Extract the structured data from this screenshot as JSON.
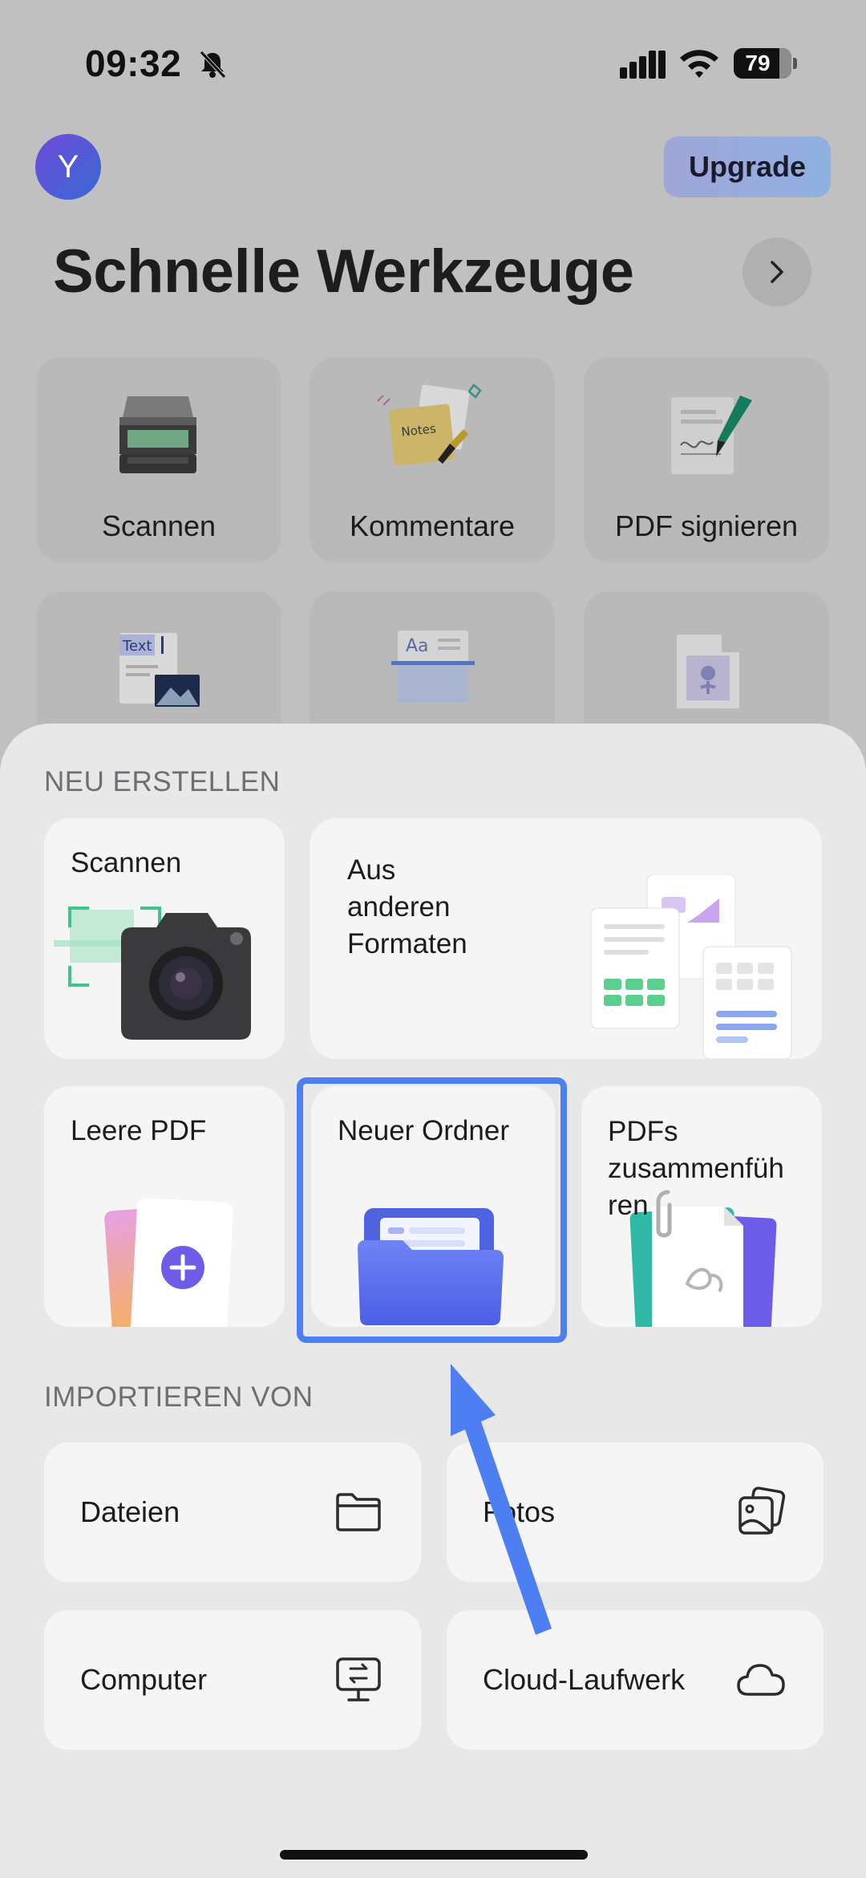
{
  "status_bar": {
    "time": "09:32",
    "battery": "79",
    "battery_level_percent": 79,
    "icons": [
      "bell-slash-icon",
      "cellular-signal-icon",
      "wifi-icon",
      "battery-icon"
    ]
  },
  "header": {
    "avatar_initial": "Y",
    "upgrade_label": "Upgrade",
    "title": "Schnelle Werkzeuge",
    "chevron_icon": "chevron-right-icon"
  },
  "tools": [
    {
      "label": "Scannen",
      "icon": "scanner-icon"
    },
    {
      "label": "Kommentare",
      "icon": "notes-icon",
      "icon_text": "Notes"
    },
    {
      "label": "PDF signieren",
      "icon": "sign-pen-icon"
    },
    {
      "label": "",
      "icon": "text-image-icon",
      "icon_text": "Text"
    },
    {
      "label": "",
      "icon": "font-scan-icon",
      "icon_text": "Aa"
    },
    {
      "label": "",
      "icon": "image-file-icon"
    }
  ],
  "sheet": {
    "create_title": "NEU ERSTELLEN",
    "create_items": {
      "scan": "Scannen",
      "formats_line1": "Aus",
      "formats_line2": "anderen",
      "formats_line3": "Formaten",
      "blank": "Leere PDF",
      "folder": "Neuer Ordner",
      "merge_line1": "PDFs",
      "merge_line2": "zusammenfüh",
      "merge_line3": "ren"
    },
    "import_title": "IMPORTIEREN VON",
    "import_items": {
      "files": "Dateien",
      "photos": "Fotos",
      "computer": "Computer",
      "cloud": "Cloud-Laufwerk"
    }
  },
  "colors": {
    "highlight": "#4d7ff2",
    "arrow": "#4d7ff2",
    "accent_purple": "#6d5ce8"
  }
}
